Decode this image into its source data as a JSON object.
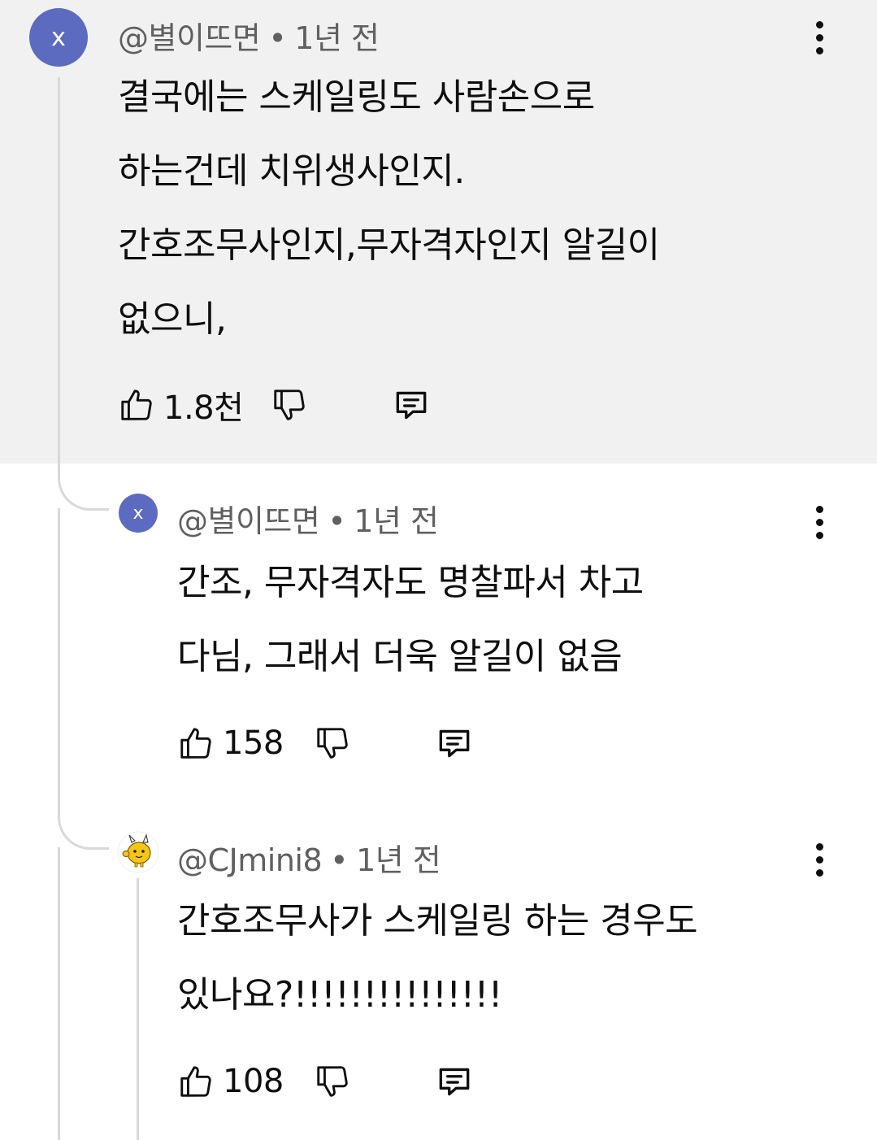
{
  "comments": [
    {
      "avatar_letter": "x",
      "author": "@별이뜨면",
      "separator": "•",
      "time": "1년 전",
      "lines": [
        "결국에는 스케일링도 사람손으로",
        "하는건데  치위생사인지.",
        "간호조무사인지,무자격자인지 알길이",
        "없으니,"
      ],
      "likes": "1.8천"
    },
    {
      "avatar_letter": "x",
      "author": "@별이뜨면",
      "separator": "•",
      "time": "1년 전",
      "lines": [
        "간조, 무자격자도 명찰파서 차고",
        "다님, 그래서 더욱 알길이 없음"
      ],
      "likes": "158"
    },
    {
      "avatar_letter": "",
      "author": "@CJmini8",
      "separator": "•",
      "time": "1년 전",
      "lines": [
        "간호조무사가 스케일링 하는 경우도",
        "있나요?!!!!!!!!!!!!!!!"
      ],
      "likes": "108"
    }
  ],
  "colors": {
    "highlight_bg": "#f1f1f1",
    "avatar_purple": "#5c6bc0",
    "meta_text": "#606060",
    "thread_line": "#d9d9d9"
  },
  "icons": {
    "like": "thumbs-up-icon",
    "dislike": "thumbs-down-icon",
    "reply": "reply-comment-icon",
    "menu": "more-vertical-icon"
  }
}
